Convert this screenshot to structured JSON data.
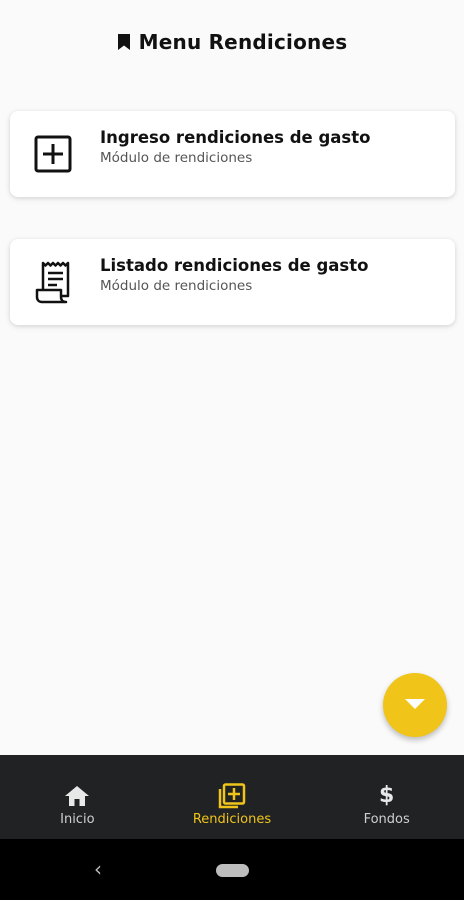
{
  "header": {
    "title": "Menu Rendiciones",
    "icon": "bookmark-icon"
  },
  "cards": [
    {
      "title": "Ingreso rendiciones de gasto",
      "subtitle": "Módulo de rendiciones",
      "icon": "add-box-icon"
    },
    {
      "title": "Listado rendiciones de gasto",
      "subtitle": "Módulo de rendiciones",
      "icon": "receipt-icon"
    }
  ],
  "fab": {
    "icon": "caret-down-icon",
    "color": "#f0c419"
  },
  "bottom_nav": {
    "items": [
      {
        "label": "Inicio",
        "icon": "home-icon",
        "active": false
      },
      {
        "label": "Rendiciones",
        "icon": "add-boxes-icon",
        "active": true
      },
      {
        "label": "Fondos",
        "icon": "dollar-icon",
        "active": false
      }
    ]
  },
  "system_nav": {
    "back_symbol": "‹"
  },
  "colors": {
    "accent": "#f0c419",
    "nav_background": "#202224",
    "page_background": "#fafafa"
  }
}
